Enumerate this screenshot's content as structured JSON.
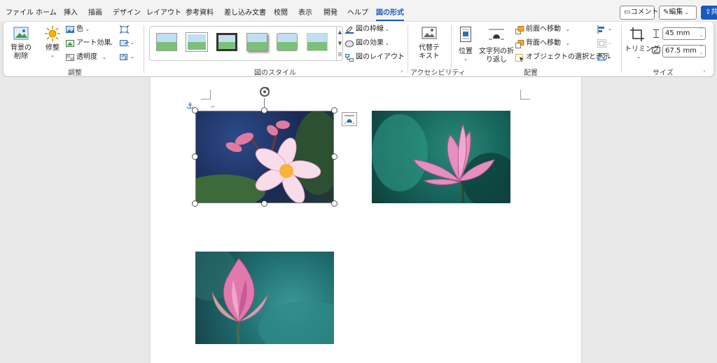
{
  "menu": {
    "tabs": [
      "ファイル",
      "ホーム",
      "挿入",
      "描画",
      "デザイン",
      "レイアウト",
      "参考資料",
      "差し込み文書",
      "校閲",
      "表示",
      "開発",
      "ヘルプ",
      "図の形式"
    ],
    "active_tab": "図の形式",
    "comment_label": "コメント",
    "edit_label": "編集",
    "share_label": "共"
  },
  "ribbon": {
    "adjust": {
      "group_label": "調整",
      "remove_bg": "背景の\n削除",
      "corrections": "修整",
      "color": "色",
      "art_effects": "アート効果",
      "transparency": "透明度"
    },
    "styles": {
      "group_label": "図のスタイル",
      "border": "図の枠線",
      "effects": "図の効果",
      "layout": "図のレイアウト"
    },
    "accessibility": {
      "group_label": "アクセシビリティ",
      "alt_text": "代替テ\nキスト"
    },
    "arrange": {
      "group_label": "配置",
      "position": "位置",
      "wrap_text": "文字列の折\nり返し",
      "bring_forward": "前面へ移動",
      "send_backward": "背面へ移動",
      "selection_pane": "オブジェクトの選択と表示"
    },
    "size": {
      "group_label": "サイズ",
      "crop": "トリミング",
      "height": "45 mm",
      "width": "67.5 mm"
    }
  },
  "colors": {
    "accent": "#185abd",
    "ribbon_bg": "#ffffff",
    "menubar_bg": "#f3f3f3",
    "canvas_bg": "#e9e9e9"
  },
  "icons": {
    "anchor": "anchor-icon",
    "rotate": "rotate-handle-icon",
    "layout_options": "layout-options-icon"
  }
}
